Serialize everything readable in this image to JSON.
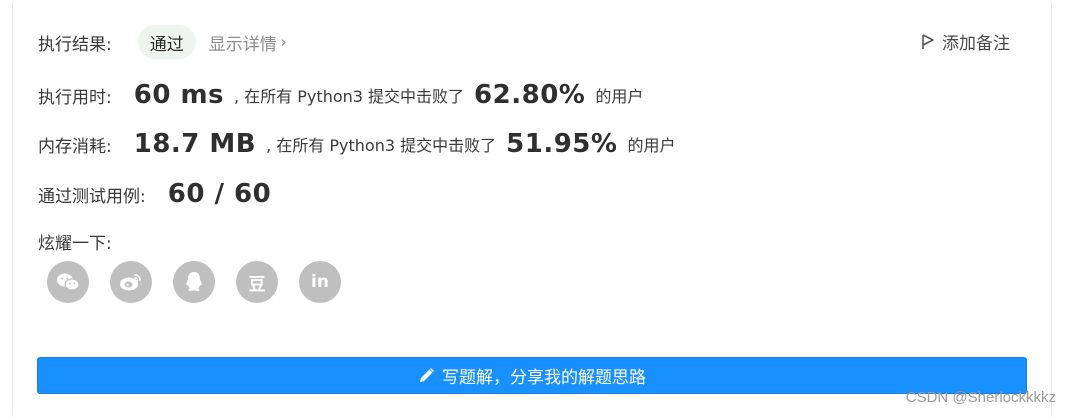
{
  "result": {
    "label": "执行结果:",
    "status": "通过",
    "detail_link": "显示详情",
    "detail_chevron": "›",
    "add_note": "添加备注"
  },
  "runtime": {
    "label": "执行用时:",
    "value": "60 ms",
    "middle": ", 在所有 Python3 提交中击败了",
    "percent": "62.80%",
    "suffix": "的用户"
  },
  "memory": {
    "label": "内存消耗:",
    "value": "18.7 MB",
    "middle": ", 在所有 Python3 提交中击败了",
    "percent": "51.95%",
    "suffix": "的用户"
  },
  "testcases": {
    "label": "通过测试用例:",
    "value": "60 / 60"
  },
  "share": {
    "label": "炫耀一下:",
    "icons": [
      "wechat-icon",
      "weibo-icon",
      "qq-icon",
      "douban-icon",
      "linkedin-icon"
    ],
    "douban_glyph": "豆",
    "linkedin_glyph": "in"
  },
  "write_button": "写题解，分享我的解题思路",
  "watermark": "CSDN @Sherlockkkkz",
  "colors": {
    "primary": "#1890ff",
    "badge_bg": "#eef5ee",
    "icon_bg": "#bfbfbf"
  }
}
